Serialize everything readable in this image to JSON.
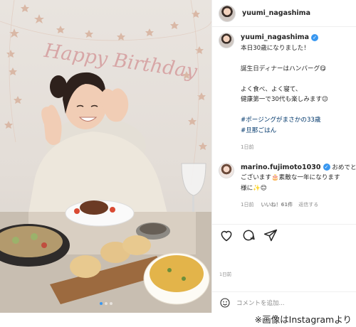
{
  "photo": {
    "banner_text": "Happy Birthday",
    "carousel_total": 3,
    "carousel_active": 0
  },
  "post": {
    "username": "yuumi_nagashima",
    "verified": true,
    "caption_lines": [
      "本日30歳になりました！",
      "",
      "誕生日ディナーはハンバーグ😋",
      "",
      "よく食べ、よく寝て、",
      "健康第一で30代も楽しみます😉"
    ],
    "hashtags": [
      "#ポージングがまさかの33歳",
      "#旦那ごはん"
    ],
    "caption_time": "1日前"
  },
  "reply": {
    "username": "marino.fujimoto1030",
    "verified": true,
    "text_lines": [
      "おめでとう",
      "ございます🎂素敵な一年になります",
      "様に✨😊"
    ],
    "time": "1日前",
    "likes": "いいね！61件",
    "reply_label": "返信する"
  },
  "actions": {
    "like": "heart-icon",
    "comment": "comment-icon",
    "share": "paper-plane-icon"
  },
  "post_time": "1日前",
  "comment_box": {
    "placeholder": "コメントを追加..."
  },
  "credit": "※画像はInstagramより",
  "colors": {
    "link": "#00376b",
    "verified": "#3897f0",
    "meta": "#8e8e8e"
  }
}
